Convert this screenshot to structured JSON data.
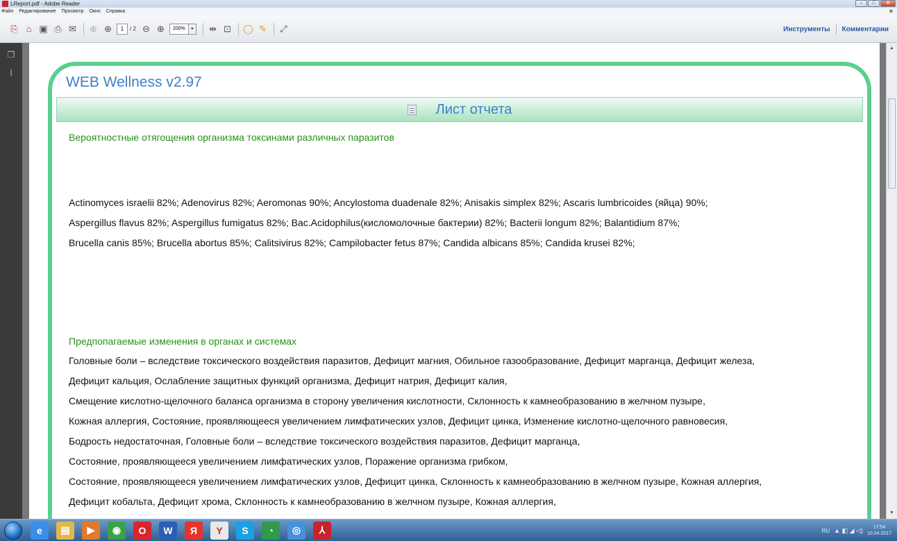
{
  "window": {
    "title": "LReport.pdf - Adobe Reader",
    "controls": [
      "–",
      "□",
      "✕"
    ]
  },
  "menu": {
    "items": [
      "Файл",
      "Редактирование",
      "Просмотр",
      "Окно",
      "Справка"
    ],
    "close_glyph": "×"
  },
  "toolbar": {
    "page_current": "1",
    "page_total": "/ 2",
    "zoom": "200%",
    "zoom_caret": "▾",
    "tools_label": "Инструменты",
    "comments_label": "Комментарии",
    "icons": [
      "create-pdf-icon",
      "open-icon",
      "save-icon",
      "print-icon",
      "email-icon",
      "prev-page-icon",
      "next-page-icon",
      "zoom-out-icon",
      "zoom-in-icon",
      "fit-width-icon",
      "fit-page-icon",
      "comment-icon",
      "highlight-icon",
      "fullscreen-icon"
    ]
  },
  "document": {
    "app_title": "WEB Wellness  v2.97",
    "report_title": "Лист отчета",
    "section1": {
      "heading": "Вероятностные отягощения организма токсинами различных паразитов",
      "lines": [
        "Actinomyces israelii 82%; Adenovirus 82%; Aeromonas 90%; Ancylostoma duadenale 82%; Anisakis simplex 82%; Ascaris lumbricoides (яйца) 90%;",
        "Aspergillus flavus 82%; Aspergillus fumigatus 82%; Bac.Acidophilus(кисломолочные бактерии) 82%; Bacterii longum 82%; Balantidium 87%;",
        "Brucella  canis 85%; Brucella abortus 85%; Calitsivirus 82%; Campilobacter fetus 87%; Candida albicans 85%; Candida krusei 82%;"
      ]
    },
    "section2": {
      "heading": "Предпопагаемые  изменения в органах и системах",
      "lines": [
        "Головные боли – вследствие токсического воздействия паразитов, Дефицит магния, Обильное газообразование, Дефицит марганца, Дефицит железа,",
        "Дефицит кальция, Ослабление защитных функций организма, Дефицит натрия, Дефицит калия,",
        "Смещение кислотно-щелочного баланса организма в сторону увеличения кислотности, Склонность к камнеобразованию в желчном пузыре,",
        "Кожная аллергия, Состояние, проявляющееся увеличением лимфатических узлов, Дефицит цинка, Изменение кислотно-щелочного равновесия,",
        "Бодрость недостаточная, Головные боли – вследствие токсического воздействия паразитов, Дефицит марганца,",
        "Состояние, проявляющееся увеличением лимфатических узлов, Поражение организма  грибком,",
        "Состояние, проявляющееся увеличением лимфатических узлов, Дефицит цинка, Склонность к камнеобразованию в желчном пузыре, Кожная аллергия,",
        "Дефицит кобальта, Дефицит хрома, Склонность к камнеобразованию в желчном пузыре, Кожная аллергия,"
      ]
    }
  },
  "taskbar": {
    "apps": [
      {
        "name": "ie-icon",
        "glyph": "e",
        "color": "#3a8ee6"
      },
      {
        "name": "explorer-icon",
        "glyph": "▤",
        "color": "#e0b84a"
      },
      {
        "name": "media-player-icon",
        "glyph": "▶",
        "color": "#e07a2a"
      },
      {
        "name": "chrome-icon",
        "glyph": "◉",
        "color": "#3aa14b"
      },
      {
        "name": "opera-icon",
        "glyph": "O",
        "color": "#d8262c"
      },
      {
        "name": "word-icon",
        "glyph": "W",
        "color": "#2b5fb4"
      },
      {
        "name": "yandex-icon",
        "glyph": "Я",
        "color": "#e6342c"
      },
      {
        "name": "yandex-browser-icon",
        "glyph": "Y",
        "color": "#e9e9e9"
      },
      {
        "name": "skype-icon",
        "glyph": "S",
        "color": "#1ba1e2"
      },
      {
        "name": "monitor-icon",
        "glyph": "◔",
        "color": "#2f9a4a"
      },
      {
        "name": "globe-icon",
        "glyph": "◎",
        "color": "#4a90d9"
      },
      {
        "name": "acrobat-icon",
        "glyph": "⅄",
        "color": "#c8232c"
      }
    ],
    "lang": "RU",
    "tray_symbols": "▲ ◧ ◢ ◁)",
    "time": "17:54",
    "date": "10.04.2017"
  }
}
